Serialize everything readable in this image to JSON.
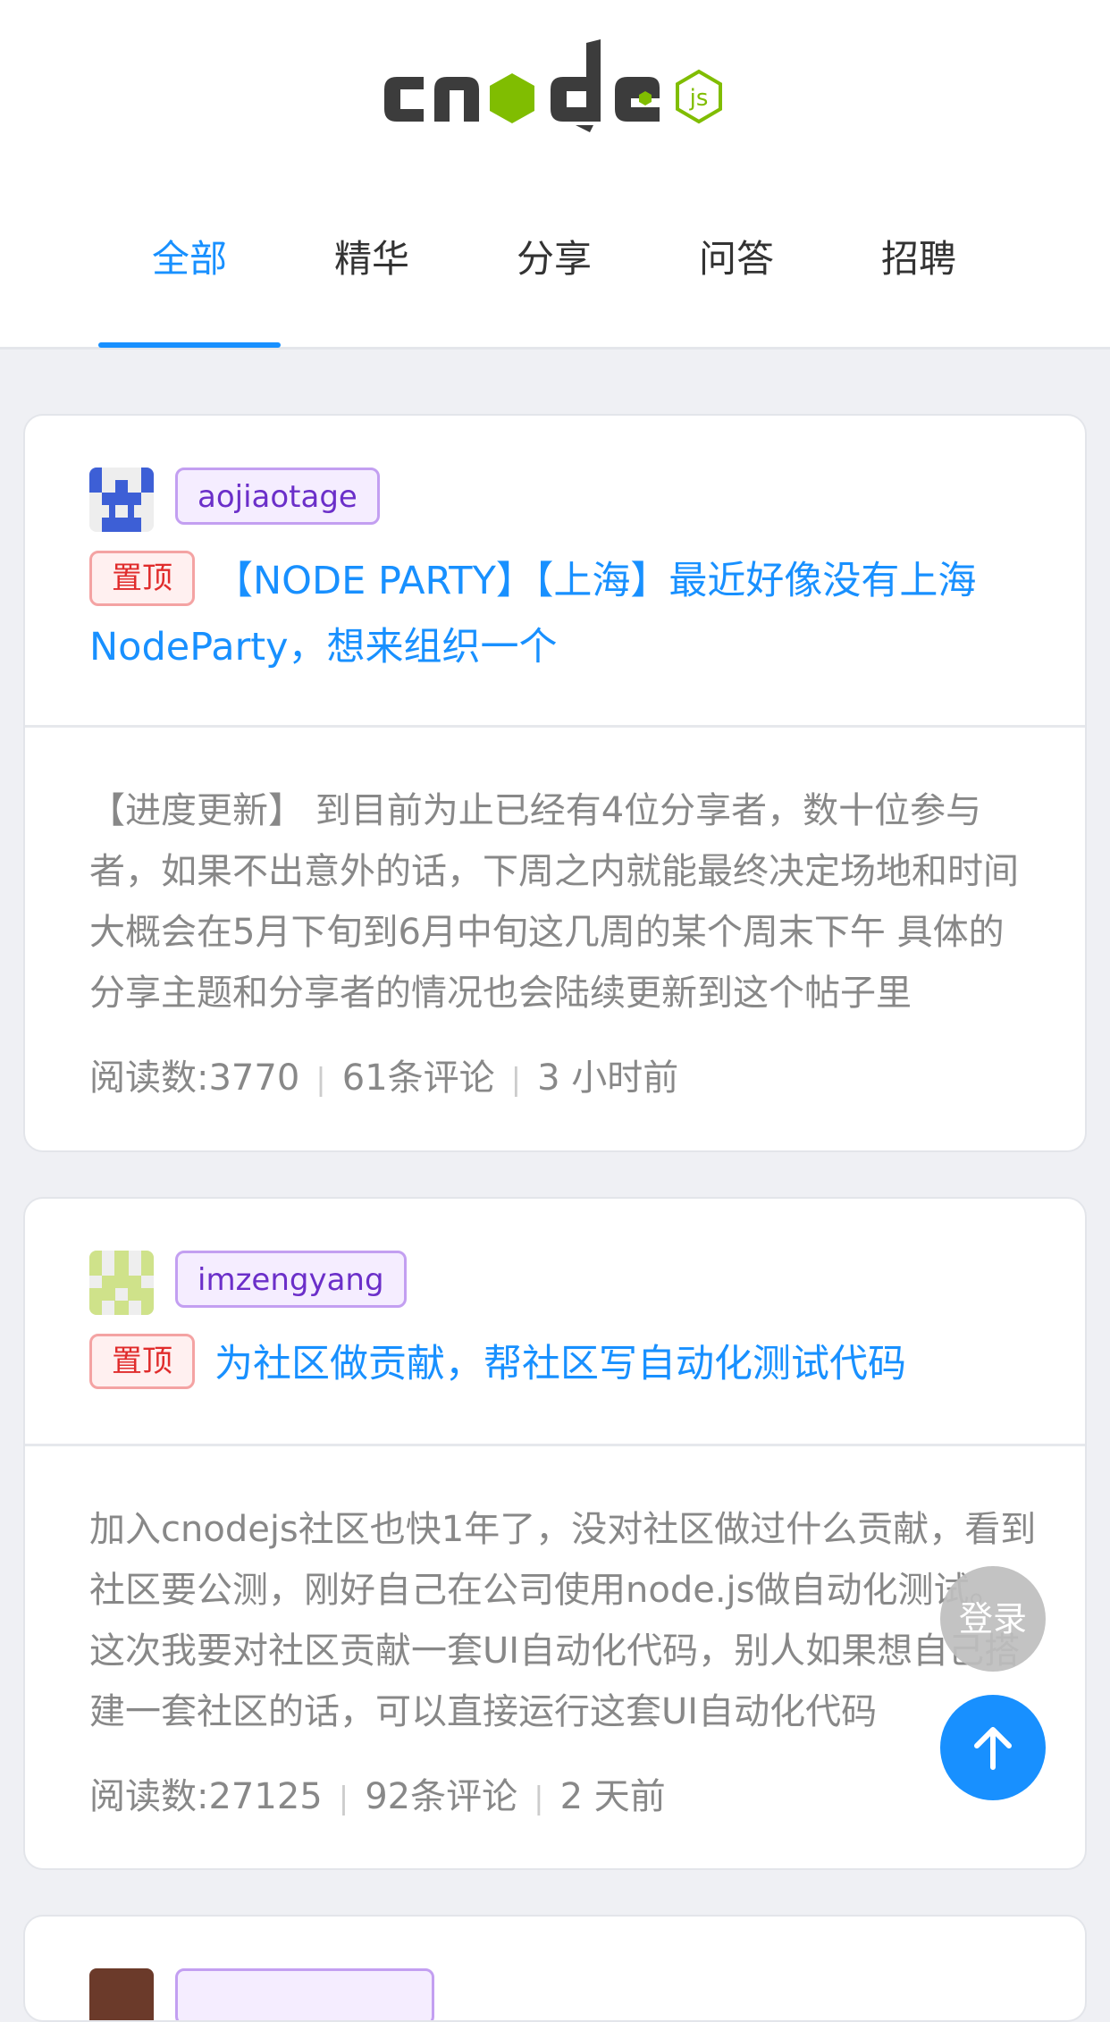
{
  "header": {
    "logo_text": "cnode js"
  },
  "tabs": [
    {
      "label": "全部",
      "active": true
    },
    {
      "label": "精华",
      "active": false
    },
    {
      "label": "分享",
      "active": false
    },
    {
      "label": "问答",
      "active": false
    },
    {
      "label": "招聘",
      "active": false
    }
  ],
  "topics": [
    {
      "author": "aojiaotage",
      "tag": "置顶",
      "title": "【NODE PARTY】【上海】最近好像没有上海NodeParty，想来组织一个",
      "excerpt": "【进度更新】 到目前为止已经有4位分享者，数十位参与者，如果不出意外的话，下周之内就能最终决定场地和时间 大概会在5月下旬到6月中旬这几周的某个周末下午 具体的分享主题和分享者的情况也会陆续更新到这个帖子里",
      "reads": "阅读数:3770",
      "comments": "61条评论",
      "time": "3 小时前"
    },
    {
      "author": "imzengyang",
      "tag": "置顶",
      "title": "为社区做贡献，帮社区写自动化测试代码",
      "excerpt": "加入cnodejs社区也快1年了，没对社区做过什么贡献，看到社区要公测，刚好自己在公司使用node.js做自动化测试。 这次我要对社区贡献一套UI自动化代码，别人如果想自己搭建一套社区的话，可以直接运行这套UI自动化代码",
      "reads": "阅读数:27125",
      "comments": "92条评论",
      "time": "2 天前"
    }
  ],
  "floating": {
    "login_label": "登录",
    "back_to_top_icon": "arrow-up-icon"
  },
  "colors": {
    "accent": "#1890ff",
    "pin_red": "#e02c2c",
    "author_purple": "#6b2fc9",
    "logo_green": "#80bd01",
    "logo_dark": "#3c3c3c"
  }
}
